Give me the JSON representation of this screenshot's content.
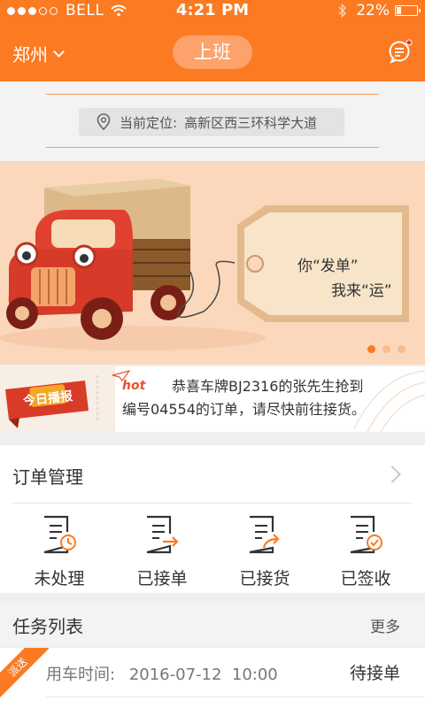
{
  "status_bar": {
    "carrier": "BELL",
    "time": "4:21 PM",
    "battery": "22%"
  },
  "nav": {
    "city": "郑州",
    "work_button": "上班"
  },
  "location": {
    "label": "当前定位:",
    "address": "高新区西三环科学大道"
  },
  "banner": {
    "line1": "你“发单”",
    "line2": "我来“运”",
    "pages": 3,
    "active_page": 0
  },
  "news": {
    "badge": "今日播报",
    "hot": "hot",
    "line1": "恭喜车牌BJ2316的张先生抢到",
    "line2": "编号04554的订单，请尽快前往接货。"
  },
  "orders": {
    "title": "订单管理",
    "items": [
      {
        "label": "未处理",
        "icon": "clock-doc-icon"
      },
      {
        "label": "已接单",
        "icon": "arrow-doc-icon"
      },
      {
        "label": "已接货",
        "icon": "send-doc-icon"
      },
      {
        "label": "已签收",
        "icon": "check-doc-icon"
      }
    ]
  },
  "tasks": {
    "title": "任务列表",
    "more": "更多",
    "items": [
      {
        "tag": "派送",
        "time_label": "用车时间:",
        "time": "2016-07-12  10:00",
        "status": "待接单"
      }
    ]
  },
  "colors": {
    "accent": "#fb7a22",
    "banner_bg": "#fbd8bb"
  }
}
